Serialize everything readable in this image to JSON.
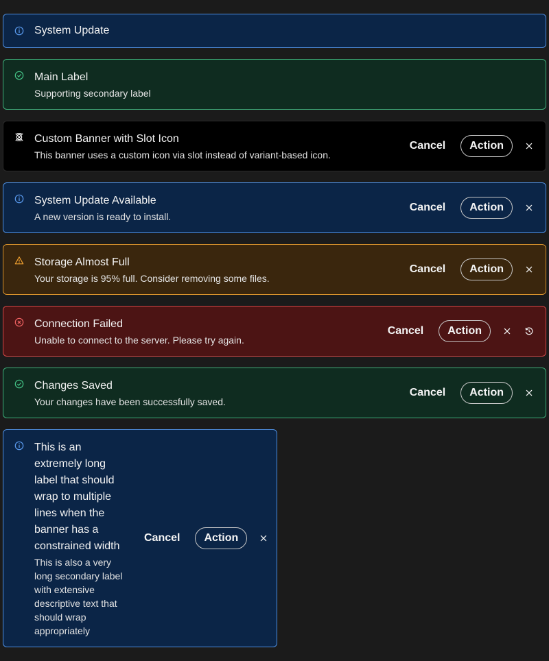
{
  "colors": {
    "page_bg": "#1b1b1b",
    "info_bg": "#0b2547",
    "info_border": "#4f8fe0",
    "info_icon": "#5b9cf0",
    "success_bg": "#0f2c20",
    "success_border": "#3fae7a",
    "success_icon": "#44c286",
    "warning_bg": "#3a260d",
    "warning_border": "#d8922c",
    "warning_icon": "#f0a030",
    "error_bg": "#4c1414",
    "error_border": "#d24848",
    "error_icon": "#ef6161",
    "custom_bg": "#000000"
  },
  "banners": [
    {
      "variant": "info",
      "icon": "info-icon",
      "label": "System Update"
    },
    {
      "variant": "success",
      "icon": "check-circle-icon",
      "label": "Main Label",
      "secondary": "Supporting secondary label"
    },
    {
      "variant": "custom",
      "icon": "custom-slot-icon",
      "label": "Custom Banner with Slot Icon",
      "secondary": "This banner uses a custom icon via slot instead of variant-based icon.",
      "cancel": "Cancel",
      "action": "Action"
    },
    {
      "variant": "info",
      "icon": "info-icon",
      "label": "System Update Available",
      "secondary": "A new version is ready to install.",
      "cancel": "Cancel",
      "action": "Action"
    },
    {
      "variant": "warning",
      "icon": "warning-icon",
      "label": "Storage Almost Full",
      "secondary": "Your storage is 95% full. Consider removing some files.",
      "cancel": "Cancel",
      "action": "Action"
    },
    {
      "variant": "error",
      "icon": "error-icon",
      "label": "Connection Failed",
      "secondary": "Unable to connect to the server. Please try again.",
      "cancel": "Cancel",
      "action": "Action"
    },
    {
      "variant": "success",
      "icon": "check-circle-icon",
      "label": "Changes Saved",
      "secondary": "Your changes have been successfully saved.",
      "cancel": "Cancel",
      "action": "Action"
    },
    {
      "variant": "info",
      "icon": "info-icon",
      "label": "This is an extremely long label that should wrap to multiple lines when the banner has a constrained width",
      "secondary": "This is also a very long secondary label with extensive descriptive text that should wrap appropriately",
      "cancel": "Cancel",
      "action": "Action"
    }
  ]
}
